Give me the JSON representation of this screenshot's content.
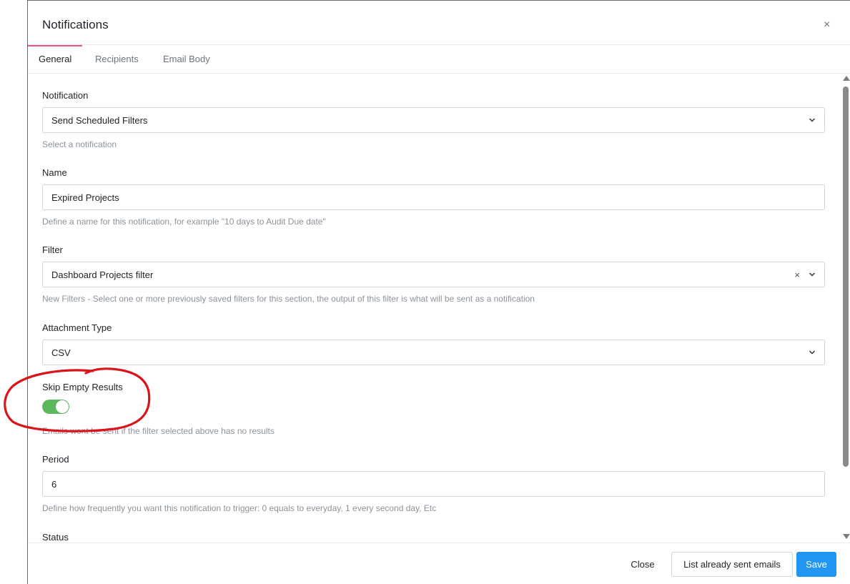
{
  "modal": {
    "title": "Notifications",
    "close_glyph": "×"
  },
  "tabs": [
    {
      "label": "General",
      "active": true
    },
    {
      "label": "Recipients",
      "active": false
    },
    {
      "label": "Email Body",
      "active": false
    }
  ],
  "form": {
    "notification": {
      "label": "Notification",
      "value": "Send Scheduled Filters",
      "help": "Select a notification"
    },
    "name": {
      "label": "Name",
      "value": "Expired Projects",
      "help": "Define a name for this notification, for example \"10 days to Audit Due date\""
    },
    "filter": {
      "label": "Filter",
      "value": "Dashboard Projects filter",
      "clear_glyph": "×",
      "help": "New Filters - Select one or more previously saved filters for this section, the output of this filter is what will be sent as a notification"
    },
    "attachment_type": {
      "label": "Attachment Type",
      "value": "CSV"
    },
    "skip_empty": {
      "label": "Skip Empty Results",
      "enabled": true,
      "help": "Emails wont be sent if the filter selected above has no results"
    },
    "period": {
      "label": "Period",
      "value": "6",
      "help": "Define how frequently you want this notification to trigger: 0 equals to everyday, 1 every second day, Etc"
    },
    "status": {
      "label": "Status"
    }
  },
  "footer": {
    "close_label": "Close",
    "list_label": "List already sent emails",
    "save_label": "Save"
  },
  "colors": {
    "accent_tab": "#e8567a",
    "toggle_on": "#5cb85c",
    "save_button": "#2196f3",
    "annotation": "#d9141b"
  }
}
